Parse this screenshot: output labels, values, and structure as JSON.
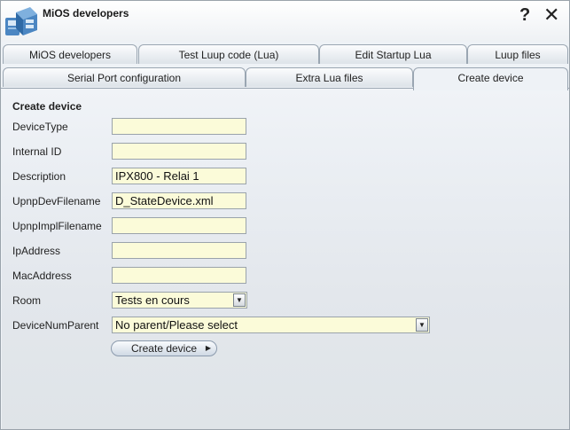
{
  "window": {
    "title": "MiOS developers"
  },
  "tabs_row1": [
    "MiOS developers",
    "Test Luup code (Lua)",
    "Edit Startup Lua",
    "Luup files"
  ],
  "tabs_row2": [
    "Serial Port configuration",
    "Extra Lua files",
    "Create device"
  ],
  "active_tab": "Create device",
  "form": {
    "section_title": "Create device",
    "fields": {
      "device_type": {
        "label": "DeviceType",
        "value": ""
      },
      "internal_id": {
        "label": "Internal ID",
        "value": ""
      },
      "description": {
        "label": "Description",
        "value": "IPX800 - Relai 1"
      },
      "upnp_dev_filename": {
        "label": "UpnpDevFilename",
        "value": "D_StateDevice.xml"
      },
      "upnp_impl_filename": {
        "label": "UpnpImplFilename",
        "value": ""
      },
      "ip_address": {
        "label": "IpAddress",
        "value": ""
      },
      "mac_address": {
        "label": "MacAddress",
        "value": ""
      }
    },
    "room": {
      "label": "Room",
      "selected": "Tests en cours"
    },
    "device_num_parent": {
      "label": "DeviceNumParent",
      "selected": "No parent/Please select"
    },
    "submit_label": "Create device"
  },
  "icons": {
    "app": "mios-device-icon",
    "help": "question-mark-icon",
    "close": "close-x-icon",
    "dropdown": "chevron-down-icon",
    "button": "chevron-right-icon"
  },
  "colors": {
    "field_background": "#fbfbd9",
    "panel_background": "#eef2f6"
  }
}
